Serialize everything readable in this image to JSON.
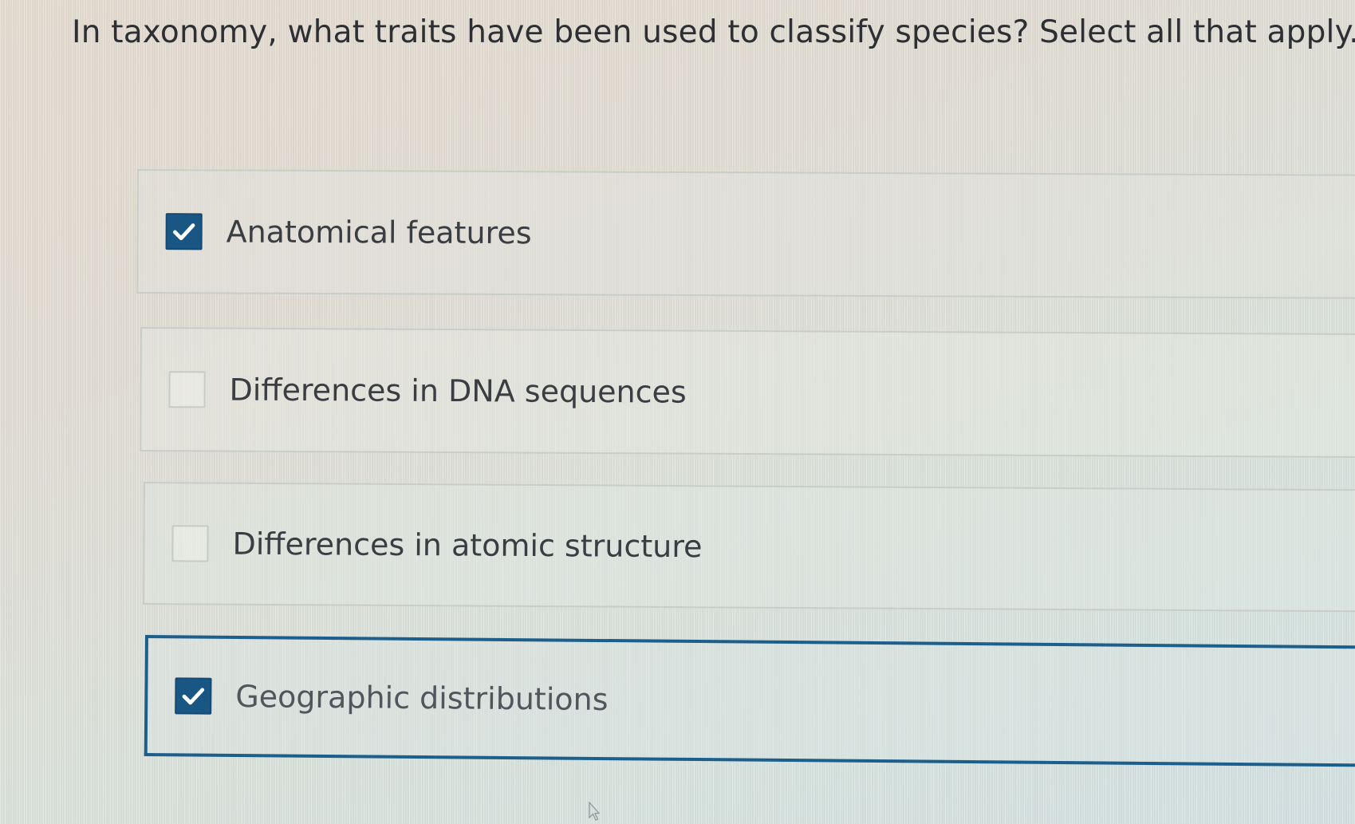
{
  "question": {
    "text": "In taxonomy, what traits have been used to classify species? Select all that apply."
  },
  "options": [
    {
      "label": "Anatomical features",
      "checked": true
    },
    {
      "label": "Differences in DNA sequences",
      "checked": false
    },
    {
      "label": "Differences in atomic structure",
      "checked": false
    },
    {
      "label": "Geographic distributions",
      "checked": true
    }
  ],
  "colors": {
    "accent": "#1a5683",
    "focus_border": "#1d5f8c",
    "text": "#2d2f33"
  },
  "icons": {
    "checked": "checkmark-icon",
    "pointer": "mouse-cursor-icon"
  }
}
